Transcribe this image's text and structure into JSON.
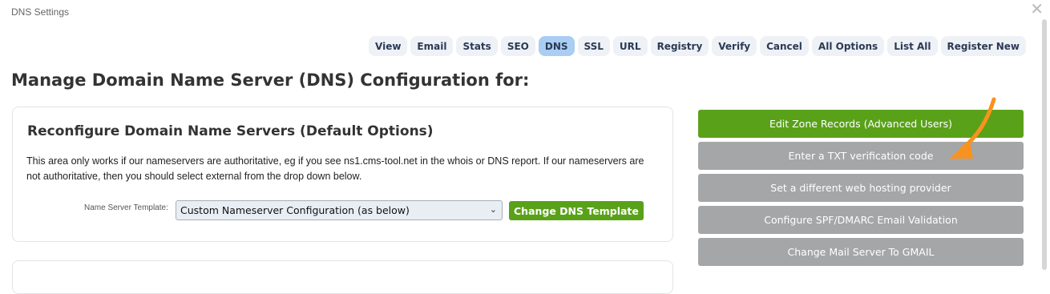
{
  "window": {
    "title": "DNS Settings"
  },
  "tabs": [
    "View",
    "Email",
    "Stats",
    "SEO",
    "DNS",
    "SSL",
    "URL",
    "Registry",
    "Verify",
    "Cancel",
    "All Options",
    "List All",
    "Register New"
  ],
  "active_tab": "DNS",
  "page": {
    "title": "Manage Domain Name Server (DNS) Configuration for:"
  },
  "card": {
    "title": "Reconfigure Domain Name Servers (Default Options)",
    "description": "This area only works if our nameservers are authoritative, eg if you see ns1.cms-tool.net in the whois or DNS report. If our nameservers are not authoritative, then you should select external from the drop down below.",
    "ns_label": "Name Server Template:",
    "ns_selected": "Custom Nameserver Configuration (as below)",
    "change_button": "Change DNS Template"
  },
  "actions": [
    "Edit Zone Records (Advanced Users)",
    "Enter a TXT verification code",
    "Set a different web hosting provider",
    "Configure SPF/DMARC Email Validation",
    "Change Mail Server To GMAIL"
  ],
  "colors": {
    "green": "#5aa11a",
    "grey": "#a5a6a8",
    "active_tab": "#a9cdf3",
    "arrow": "#f7931e"
  }
}
